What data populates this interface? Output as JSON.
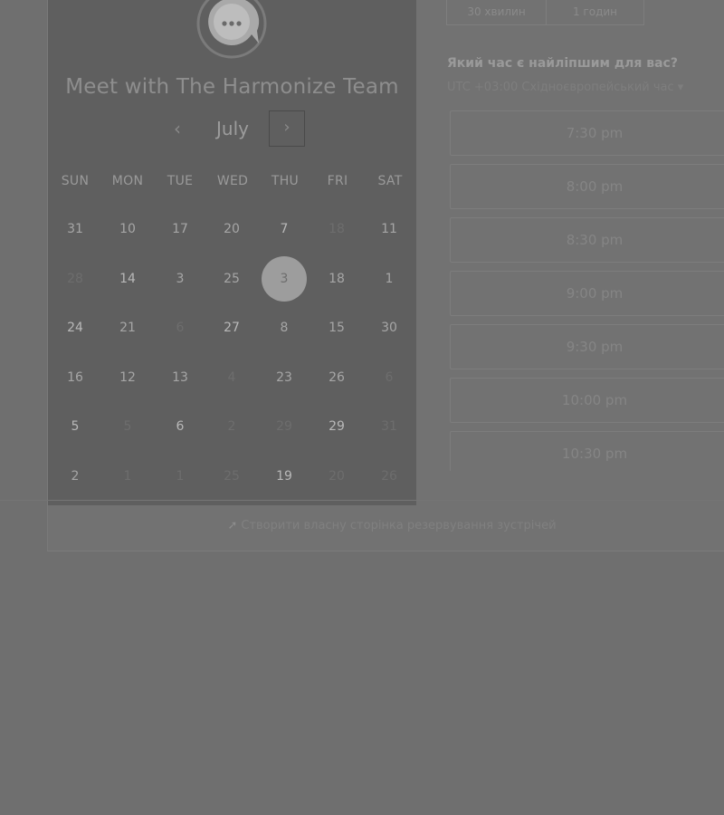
{
  "header": {
    "title": "Meet with The Harmonize Team",
    "logo_icon": "chat-bubble-icon"
  },
  "calendar": {
    "month": "July",
    "prev_icon": "‹",
    "next_icon": "›",
    "weekdays": [
      "SUN",
      "MON",
      "TUE",
      "WED",
      "THU",
      "FRI",
      "SAT"
    ],
    "weeks": [
      [
        {
          "d": "31",
          "s": "normal"
        },
        {
          "d": "10",
          "s": "normal"
        },
        {
          "d": "17",
          "s": "normal"
        },
        {
          "d": "20",
          "s": "normal"
        },
        {
          "d": "7",
          "s": "bright"
        },
        {
          "d": "18",
          "s": "muted"
        },
        {
          "d": "11",
          "s": "normal"
        }
      ],
      [
        {
          "d": "28",
          "s": "muted"
        },
        {
          "d": "14",
          "s": "bright"
        },
        {
          "d": "3",
          "s": "normal"
        },
        {
          "d": "25",
          "s": "normal"
        },
        {
          "d": "3",
          "s": "selected"
        },
        {
          "d": "18",
          "s": "normal"
        },
        {
          "d": "1",
          "s": "normal"
        }
      ],
      [
        {
          "d": "24",
          "s": "bright"
        },
        {
          "d": "21",
          "s": "normal"
        },
        {
          "d": "6",
          "s": "muted"
        },
        {
          "d": "27",
          "s": "bright"
        },
        {
          "d": "8",
          "s": "normal"
        },
        {
          "d": "15",
          "s": "normal"
        },
        {
          "d": "30",
          "s": "normal"
        }
      ],
      [
        {
          "d": "16",
          "s": "normal"
        },
        {
          "d": "12",
          "s": "normal"
        },
        {
          "d": "13",
          "s": "normal"
        },
        {
          "d": "4",
          "s": "muted"
        },
        {
          "d": "23",
          "s": "normal"
        },
        {
          "d": "26",
          "s": "normal"
        },
        {
          "d": "6",
          "s": "muted"
        }
      ],
      [
        {
          "d": "5",
          "s": "bright"
        },
        {
          "d": "5",
          "s": "muted"
        },
        {
          "d": "6",
          "s": "bright"
        },
        {
          "d": "2",
          "s": "muted"
        },
        {
          "d": "29",
          "s": "muted"
        },
        {
          "d": "29",
          "s": "bright"
        },
        {
          "d": "31",
          "s": "muted"
        }
      ],
      [
        {
          "d": "2",
          "s": "normal"
        },
        {
          "d": "1",
          "s": "muted"
        },
        {
          "d": "1",
          "s": "muted"
        },
        {
          "d": "25",
          "s": "muted"
        },
        {
          "d": "19",
          "s": "bright"
        },
        {
          "d": "20",
          "s": "muted"
        },
        {
          "d": "26",
          "s": "muted"
        }
      ]
    ]
  },
  "durations": {
    "tab1": "30 хвилин",
    "tab2": "1 годин"
  },
  "schedule": {
    "heading": "Який час є найліпшим для вас?",
    "timezone": "UTC +03:00 Східноєвропейський час ▾",
    "slots": [
      "7:30 pm",
      "8:00 pm",
      "8:30 pm",
      "9:00 pm",
      "9:30 pm",
      "10:00 pm",
      "10:30 pm"
    ]
  },
  "footer": {
    "arrow_icon": "arrow-icon",
    "link_text": "Створити власну сторінка резервування зустрічей"
  }
}
